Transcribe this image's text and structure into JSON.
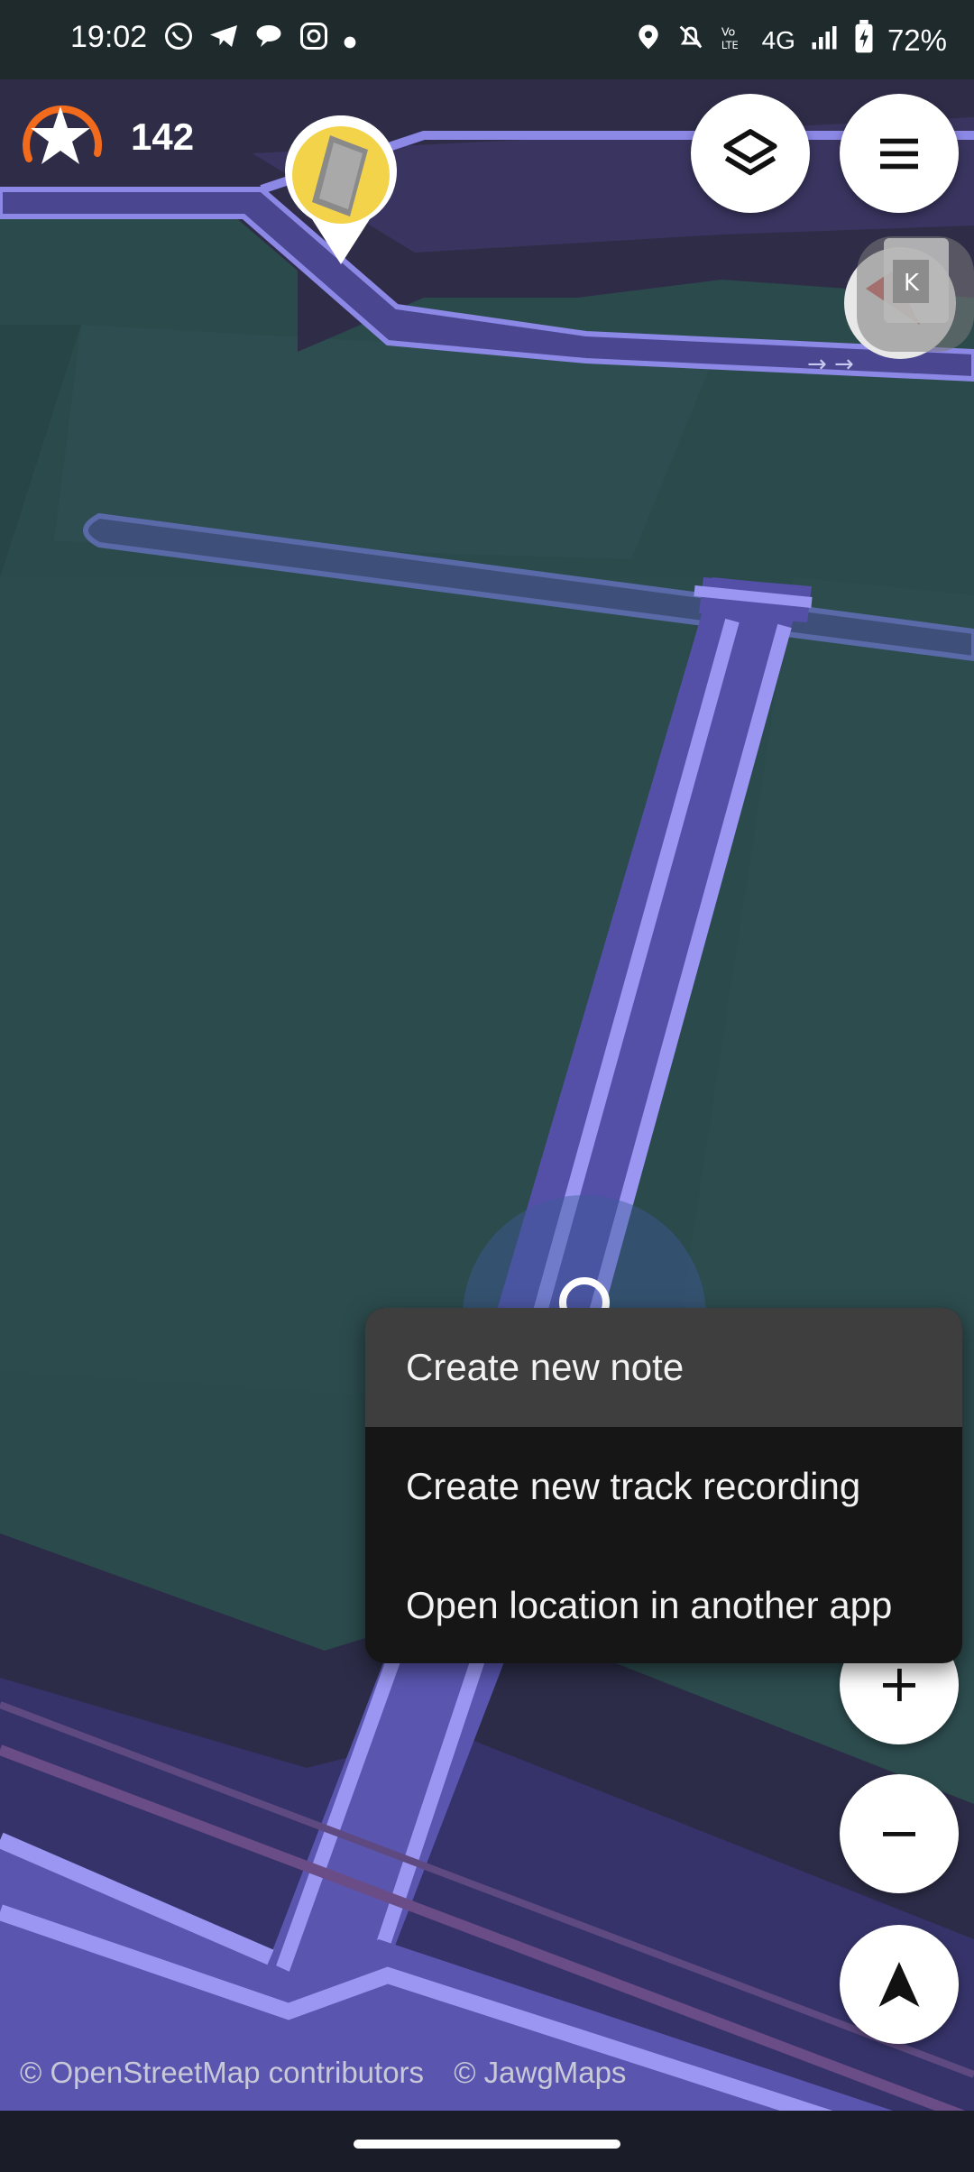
{
  "status_bar": {
    "time": "19:02",
    "battery": "72%",
    "network": "4G",
    "left_icons": [
      "whatsapp-icon",
      "telegram-icon",
      "chat-icon",
      "instagram-icon",
      "dot-icon"
    ],
    "right_icons": [
      "location-icon",
      "bell-off-icon",
      "volte-icon",
      "signal-icon",
      "battery-charging-icon"
    ]
  },
  "stars": {
    "count": "142"
  },
  "context_menu": {
    "items": [
      {
        "label": "Create new note"
      },
      {
        "label": "Create new track recording"
      },
      {
        "label": "Open location in another app"
      }
    ]
  },
  "attribution": {
    "osm": "© OpenStreetMap contributors",
    "jawg": "© JawgMaps"
  },
  "colors": {
    "map_ground": "#2b4a4c",
    "road_fill": "#5a56a8",
    "road_edge": "#9a96f2",
    "accent_orange": "#f26a1b",
    "menu_bg": "#161616"
  }
}
